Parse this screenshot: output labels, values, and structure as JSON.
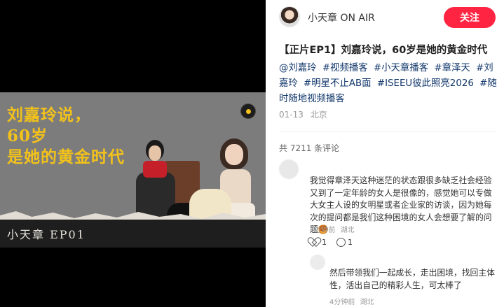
{
  "video_cover": {
    "title_lines": [
      "刘嘉玲说，",
      "60岁",
      "是她的黄金时代"
    ],
    "episode_label": "小天章 EP01"
  },
  "author": {
    "name": "小天章 ON AIR",
    "follow_label": "关注"
  },
  "post": {
    "title": "【正片EP1】刘嘉玲说，60岁是她的黄金时代",
    "tags": [
      "@刘嘉玲",
      "#视频播客",
      "#小天章播客",
      "#章泽天",
      "#刘嘉玲",
      "#明星不止AB面",
      "#ISEEU彼此照亮2026",
      "#随时随地视频播客"
    ],
    "date": "01-13",
    "location": "北京"
  },
  "comments_header": "共 7211 条评论",
  "comment": {
    "text": "我觉得章泽天这种迷茫的状态跟很多缺乏社会经验又到了一定年龄的女人是很像的，感觉她可以专做大女主人设的女明星或者企业家的访谈，因为她每次的提问都是我们这种困境的女人会想要了解的问题🥮",
    "time": "7分钟前",
    "location": "湖北",
    "likes": "1",
    "replies": "1"
  },
  "reply": {
    "text": "然后带领我们一起成长，走出困境，找回主体性，活出自己的精彩人生，可太棒了",
    "time": "4分钟前",
    "location": "湖北"
  }
}
